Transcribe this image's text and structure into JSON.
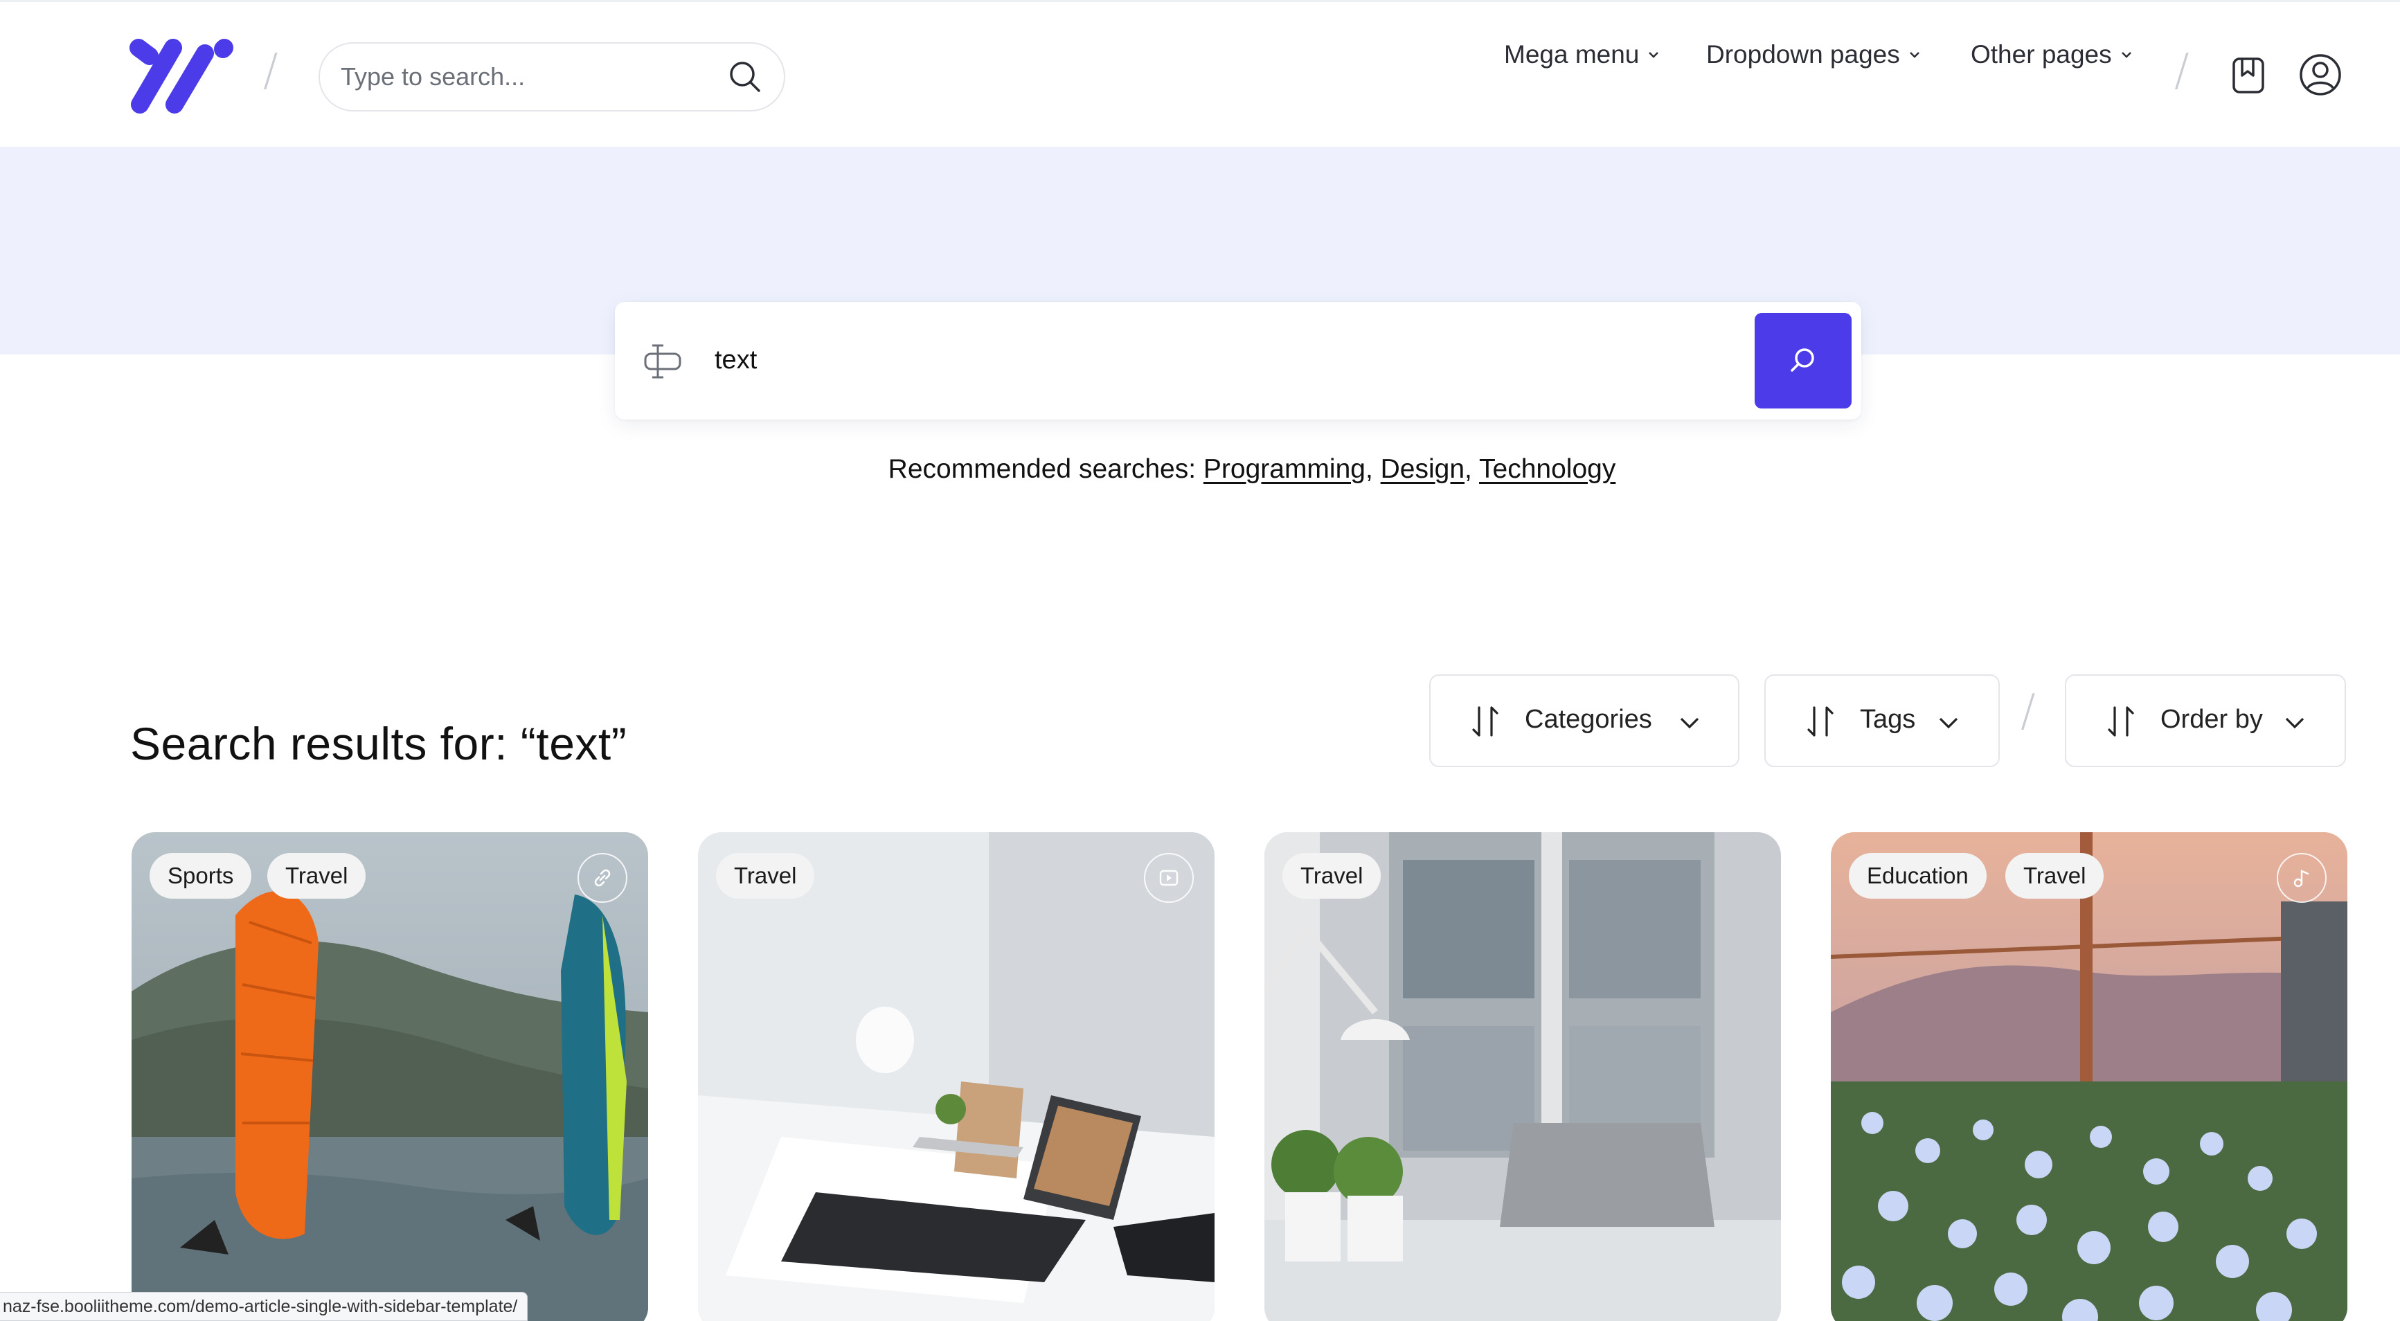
{
  "header": {
    "search_placeholder": "Type to search...",
    "nav": [
      {
        "label": "Mega menu"
      },
      {
        "label": "Dropdown pages"
      },
      {
        "label": "Other pages"
      }
    ]
  },
  "search": {
    "query": "text"
  },
  "recommended": {
    "prefix": "Recommended searches:",
    "links": [
      "Programming",
      "Design",
      "Technology"
    ]
  },
  "results": {
    "title": "Search results for: “text”"
  },
  "filters": [
    {
      "label": "Categories"
    },
    {
      "label": "Tags"
    },
    {
      "label": "Order by"
    }
  ],
  "cards": [
    {
      "tags": [
        "Sports",
        "Travel"
      ],
      "media_icon": "link-icon"
    },
    {
      "tags": [
        "Travel"
      ],
      "media_icon": "video-icon"
    },
    {
      "tags": [
        "Travel"
      ],
      "media_icon": ""
    },
    {
      "tags": [
        "Education",
        "Travel"
      ],
      "media_icon": "music-icon"
    }
  ],
  "status_url": "naz-fse.booliitheme.com/demo-article-single-with-sidebar-template/",
  "colors": {
    "accent": "#4b3be8",
    "hero_band": "#eef1fd"
  }
}
